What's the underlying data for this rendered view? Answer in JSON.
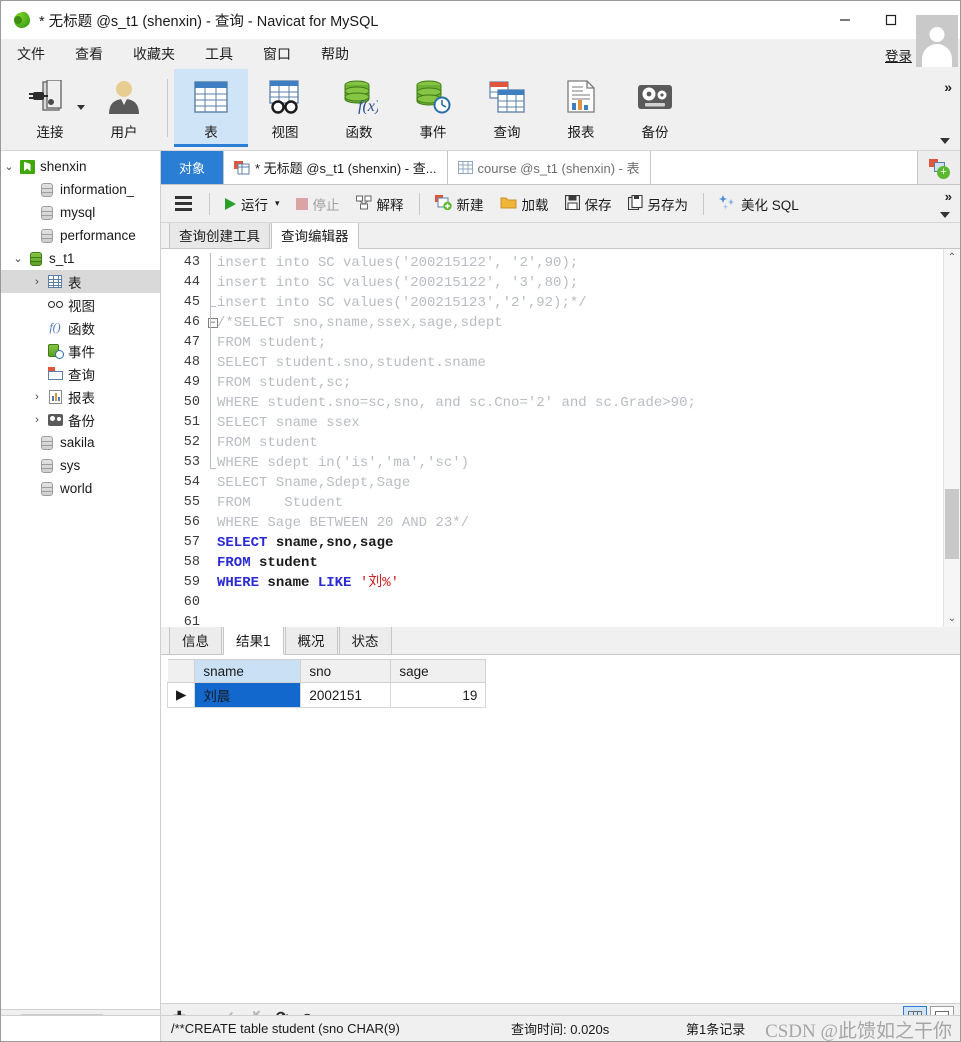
{
  "window": {
    "title": "* 无标题 @s_t1 (shenxin) - 查询 - Navicat for MySQL",
    "app_icon": "navicat-leaf-icon",
    "minimize": "—",
    "maximize": "▭",
    "close": "✕"
  },
  "menubar": {
    "items": [
      {
        "label": "文件",
        "name": "menu-file"
      },
      {
        "label": "查看",
        "name": "menu-view"
      },
      {
        "label": "收藏夹",
        "name": "menu-favorites"
      },
      {
        "label": "工具",
        "name": "menu-tools"
      },
      {
        "label": "窗口",
        "name": "menu-window"
      },
      {
        "label": "帮助",
        "name": "menu-help"
      }
    ],
    "login_label": "登录"
  },
  "toolbar": {
    "items": [
      {
        "label": "连接",
        "icon": "connection-icon",
        "active": false,
        "has_dropdown": true
      },
      {
        "label": "用户",
        "icon": "user-icon",
        "active": false,
        "has_dropdown": false
      },
      {
        "label": "表",
        "icon": "table-icon",
        "active": true,
        "has_dropdown": false
      },
      {
        "label": "视图",
        "icon": "view-icon",
        "active": false,
        "has_dropdown": false
      },
      {
        "label": "函数",
        "icon": "function-icon",
        "active": false,
        "has_dropdown": false
      },
      {
        "label": "事件",
        "icon": "event-icon",
        "active": false,
        "has_dropdown": false
      },
      {
        "label": "查询",
        "icon": "query-icon",
        "active": false,
        "has_dropdown": false
      },
      {
        "label": "报表",
        "icon": "report-icon",
        "active": false,
        "has_dropdown": false
      },
      {
        "label": "备份",
        "icon": "backup-icon",
        "active": false,
        "has_dropdown": false
      }
    ],
    "overflow": "»"
  },
  "sidebar": {
    "tree": [
      {
        "label": "shenxin",
        "icon": "navicat-connection-icon",
        "indent": 0,
        "twist": "⌄",
        "selected": false
      },
      {
        "label": "information_",
        "icon": "database-icon",
        "indent": 1,
        "twist": "",
        "selected": false
      },
      {
        "label": "mysql",
        "icon": "database-icon",
        "indent": 1,
        "twist": "",
        "selected": false
      },
      {
        "label": "performance",
        "icon": "database-icon",
        "indent": 1,
        "twist": "",
        "selected": false
      },
      {
        "label": "s_t1",
        "icon": "database-open-icon",
        "indent": 1,
        "twist": "⌄",
        "selected": false
      },
      {
        "label": "表",
        "icon": "tables-folder-icon",
        "indent": 2,
        "twist": "›",
        "selected": true
      },
      {
        "label": "视图",
        "icon": "views-folder-icon",
        "indent": 2,
        "twist": "",
        "selected": false
      },
      {
        "label": "函数",
        "icon": "functions-folder-icon",
        "indent": 2,
        "twist": "",
        "selected": false
      },
      {
        "label": "事件",
        "icon": "events-folder-icon",
        "indent": 2,
        "twist": "",
        "selected": false
      },
      {
        "label": "查询",
        "icon": "queries-folder-icon",
        "indent": 2,
        "twist": "",
        "selected": false
      },
      {
        "label": "报表",
        "icon": "reports-folder-icon",
        "indent": 2,
        "twist": "›",
        "selected": false
      },
      {
        "label": "备份",
        "icon": "backups-folder-icon",
        "indent": 2,
        "twist": "›",
        "selected": false
      },
      {
        "label": "sakila",
        "icon": "database-icon",
        "indent": 1,
        "twist": "",
        "selected": false
      },
      {
        "label": "sys",
        "icon": "database-icon",
        "indent": 1,
        "twist": "",
        "selected": false
      },
      {
        "label": "world",
        "icon": "database-icon",
        "indent": 1,
        "twist": "",
        "selected": false
      }
    ],
    "scroll_left": "‹",
    "scroll_right": "›"
  },
  "tabs": {
    "items": [
      {
        "label": "对象",
        "type": "object",
        "active": false,
        "icon": ""
      },
      {
        "label": "* 无标题 @s_t1 (shenxin) - 查...",
        "type": "query",
        "active": true,
        "icon": "query-tab-icon"
      },
      {
        "label": "course @s_t1 (shenxin) - 表",
        "type": "table",
        "active": false,
        "icon": "table-tab-icon"
      }
    ],
    "new_tab_icon": "new-tab-icon"
  },
  "query_toolbar": {
    "menu_icon": "hamburger-menu-icon",
    "buttons": [
      {
        "label": "运行",
        "icon": "run-icon",
        "disabled": false,
        "dropdown": true
      },
      {
        "label": "停止",
        "icon": "stop-icon",
        "disabled": true,
        "dropdown": false
      },
      {
        "label": "解释",
        "icon": "explain-icon",
        "disabled": false,
        "dropdown": false
      },
      {
        "label": "新建",
        "icon": "new-icon",
        "disabled": false,
        "dropdown": false
      },
      {
        "label": "加载",
        "icon": "load-icon",
        "disabled": false,
        "dropdown": false
      },
      {
        "label": "保存",
        "icon": "save-icon",
        "disabled": false,
        "dropdown": false
      },
      {
        "label": "另存为",
        "icon": "save-as-icon",
        "disabled": false,
        "dropdown": false
      },
      {
        "label": "美化 SQL",
        "icon": "beautify-sql-icon",
        "disabled": false,
        "dropdown": false
      }
    ],
    "overflow": "»"
  },
  "sub_tabs": [
    {
      "label": "查询创建工具",
      "active": false
    },
    {
      "label": "查询编辑器",
      "active": true
    }
  ],
  "editor": {
    "lines": [
      {
        "num": "43",
        "text": "insert into SC values('200215122', '2',90);",
        "style": "comment",
        "fold": ""
      },
      {
        "num": "44",
        "text": "insert into SC values('200215122', '3',80);",
        "style": "comment",
        "fold": ""
      },
      {
        "num": "45",
        "text": "insert into SC values('200215123','2',92);*/",
        "style": "comment",
        "fold": ""
      },
      {
        "num": "46",
        "text": "/*SELECT sno,sname,ssex,sage,sdept",
        "style": "comment",
        "fold": "⊟"
      },
      {
        "num": "47",
        "text": "FROM student;",
        "style": "comment",
        "fold": ""
      },
      {
        "num": "48",
        "text": "SELECT student.sno,student.sname",
        "style": "comment",
        "fold": ""
      },
      {
        "num": "49",
        "text": "FROM student,sc;",
        "style": "comment",
        "fold": ""
      },
      {
        "num": "50",
        "text": "WHERE student.sno=sc,sno, and sc.Cno='2' and sc.Grade>90;",
        "style": "comment",
        "fold": ""
      },
      {
        "num": "51",
        "text": "SELECT sname ssex",
        "style": "comment",
        "fold": ""
      },
      {
        "num": "52",
        "text": "FROM student",
        "style": "comment",
        "fold": ""
      },
      {
        "num": "53",
        "text": "WHERE sdept in('is','ma','sc')",
        "style": "comment",
        "fold": ""
      },
      {
        "num": "54",
        "text": "SELECT Sname,Sdept,Sage",
        "style": "comment",
        "fold": ""
      },
      {
        "num": "55",
        "text": "FROM    Student",
        "style": "comment",
        "fold": ""
      },
      {
        "num": "56",
        "text": "WHERE Sage BETWEEN 20 AND 23*/",
        "style": "comment",
        "fold": ""
      },
      {
        "num": "57",
        "text": "SELECT sname,sno,sage",
        "style": "sql",
        "fold": ""
      },
      {
        "num": "58",
        "text": "FROM student",
        "style": "sql",
        "fold": ""
      },
      {
        "num": "59",
        "text": "WHERE sname LIKE '刘%'",
        "style": "sql",
        "fold": ""
      },
      {
        "num": "60",
        "text": "",
        "style": "sql",
        "fold": ""
      },
      {
        "num": "61",
        "text": "",
        "style": "sql",
        "fold": ""
      }
    ],
    "syntax_colors": {
      "comment": "#b9bcc2",
      "keyword": "#2a2ad4",
      "identifier": "#1a1a1a",
      "string": "#cc2222"
    }
  },
  "result_tabs": [
    {
      "label": "信息",
      "active": false
    },
    {
      "label": "结果1",
      "active": true
    },
    {
      "label": "概况",
      "active": false
    },
    {
      "label": "状态",
      "active": false
    }
  ],
  "result_grid": {
    "columns": [
      "sname",
      "sno",
      "sage"
    ],
    "current_column": "sname",
    "rows": [
      {
        "indicator": "▶",
        "sname": "刘晨",
        "sno": "2002151",
        "sage": "19",
        "selected_cell": "sname"
      }
    ]
  },
  "grid_toolbar": {
    "buttons": [
      {
        "icon": "add-record-icon",
        "glyph": "✚",
        "disabled": false
      },
      {
        "icon": "delete-record-icon",
        "glyph": "━",
        "disabled": false
      },
      {
        "icon": "apply-change-icon",
        "glyph": "✓",
        "disabled": true
      },
      {
        "icon": "cancel-change-icon",
        "glyph": "✗",
        "disabled": true
      },
      {
        "icon": "refresh-icon",
        "glyph": "⟳",
        "disabled": false
      },
      {
        "icon": "stop-loading-icon",
        "glyph": "⦸",
        "disabled": false
      }
    ],
    "view_modes": [
      {
        "name": "grid-view",
        "active": true
      },
      {
        "name": "form-view",
        "active": false
      }
    ]
  },
  "statusbar": {
    "sql_text": "/**CREATE table student (sno CHAR(9)",
    "query_time": "查询时间: 0.020s",
    "record_info": "第1条记录",
    "watermark": "CSDN @此馈如之干你"
  }
}
